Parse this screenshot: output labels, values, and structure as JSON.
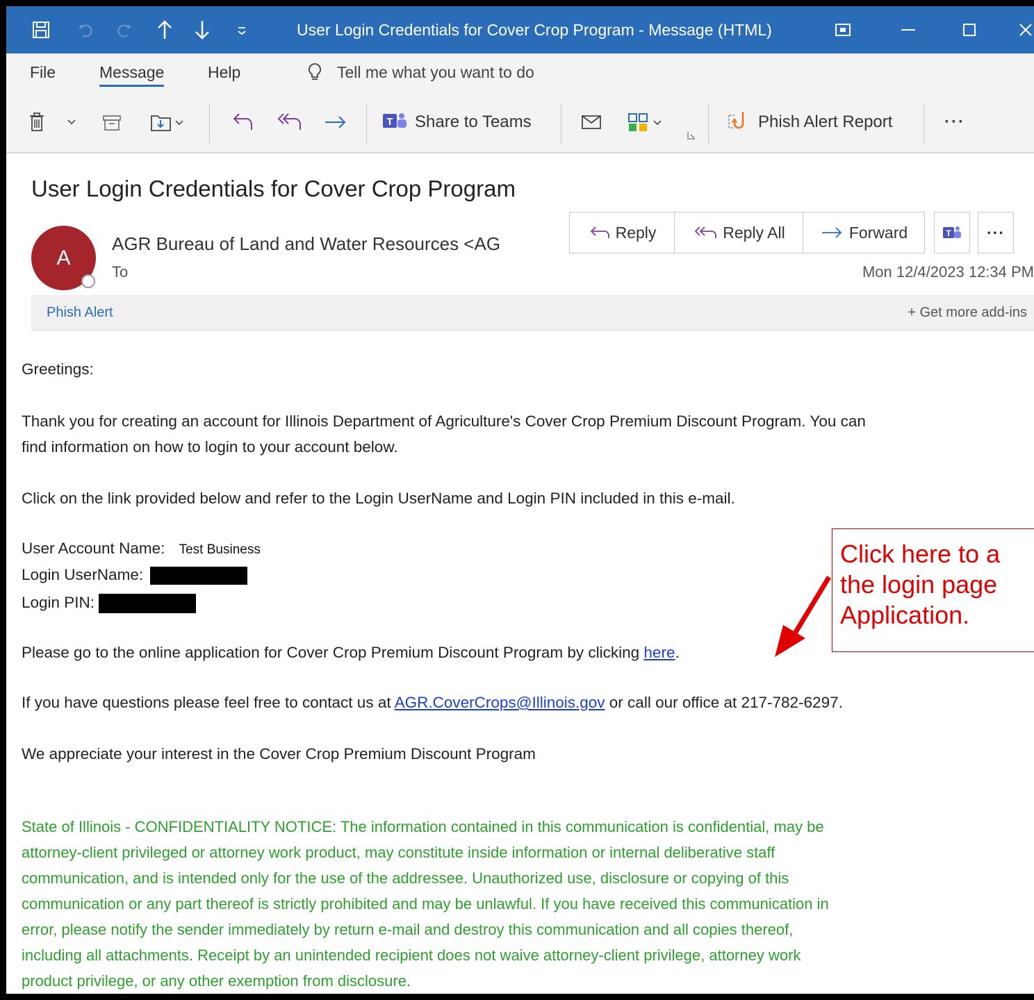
{
  "window": {
    "title": "User Login Credentials for Cover Crop Program  -  Message (HTML)",
    "controls": [
      "restore-icon",
      "minimize-icon",
      "maximize-icon",
      "close-icon"
    ]
  },
  "menu": {
    "file": "File",
    "message": "Message",
    "help": "Help",
    "tell_me": "Tell me what you want to do"
  },
  "toolbar": {
    "share_teams": "Share to Teams",
    "phish_report": "Phish Alert Report",
    "more": "···"
  },
  "message": {
    "subject": "User Login Credentials for Cover Crop Program",
    "avatar_initial": "A",
    "sender": "AGR Bureau of Land and Water Resources <AG",
    "to_label": "To",
    "timestamp": "Mon 12/4/2023 12:34 PM",
    "actions": {
      "reply": "Reply",
      "reply_all": "Reply All",
      "forward": "Forward",
      "more": "···"
    }
  },
  "addins": {
    "phish_alert": "Phish Alert",
    "get_more": "+  Get more add-ins"
  },
  "body": {
    "greeting": "Greetings:",
    "para1_line1": "Thank you for creating an account for Illinois Department of Agriculture's Cover Crop Premium Discount Program. You can",
    "para1_line2": "find information on how to login to your account below.",
    "para2": "Click on the link provided below and refer to the Login UserName and Login PIN included in this e-mail.",
    "account_label": "User Account Name:",
    "account_value": "Test Business",
    "username_label": "Login UserName:",
    "pin_label": "Login PIN:",
    "para3_text": "Please go to the online application for Cover Crop Premium Discount Program by clicking ",
    "para3_link": "here",
    "para3_end": ".",
    "para4_text": "If you have questions please feel free to contact us at ",
    "para4_email": "AGR.CoverCrops@Illinois.gov",
    "para4_end": " or call our office at 217-782-6297.",
    "para5": "We appreciate your interest in the Cover Crop Premium Discount Program",
    "notice": [
      "State of Illinois - CONFIDENTIALITY NOTICE: The information contained in this communication is confidential, may be",
      "attorney-client privileged or attorney work product, may constitute inside information or internal deliberative staff",
      "communication, and is intended only for the use of the addressee. Unauthorized use, disclosure or copying of this",
      "communication or any part thereof is strictly prohibited and may be unlawful. If you have received this communication in",
      "error, please notify the sender immediately by return e-mail and destroy this communication and all copies thereof,",
      "including all attachments. Receipt by an unintended recipient does not waive attorney-client privilege, attorney work",
      "product privilege, or any other exemption from disclosure."
    ]
  },
  "callout": {
    "lines": [
      "Click here to a",
      "the login page",
      "Application."
    ],
    "color": "#e00000"
  },
  "colors": {
    "titlebar": "#2b6cb8",
    "avatar": "#a4262c",
    "notice": "#2e9f2e",
    "link": "#1a3ed6"
  }
}
